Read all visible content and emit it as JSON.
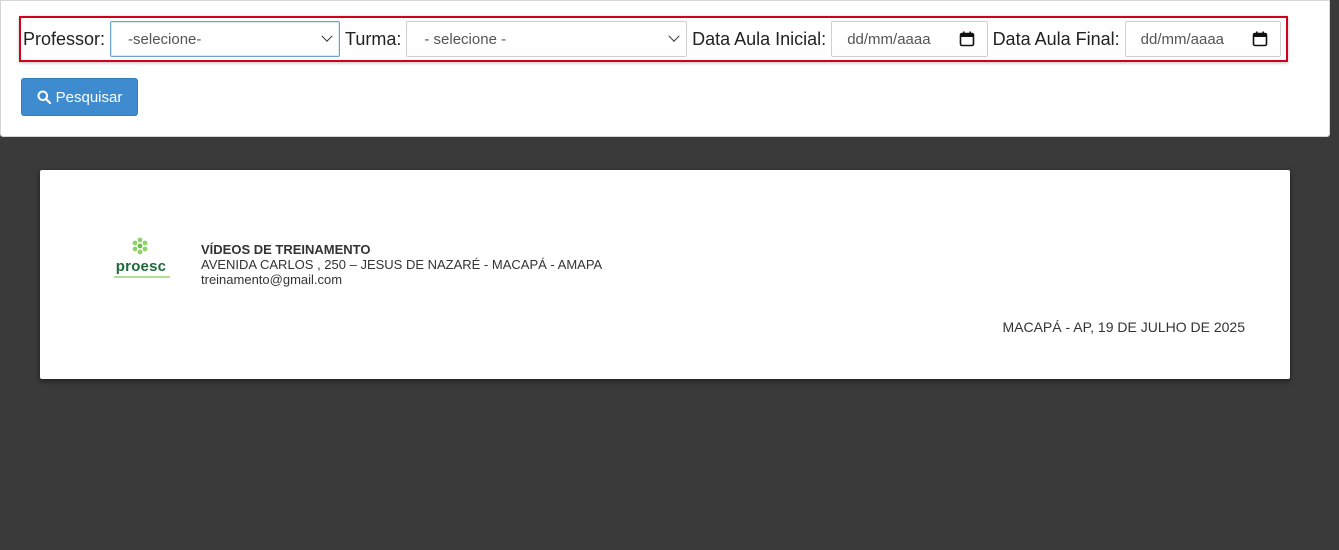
{
  "filters": {
    "professor_label": "Professor:",
    "professor_value": "-selecione-",
    "turma_label": "Turma:",
    "turma_value": "- selecione -",
    "data_inicial_label": "Data Aula Inicial:",
    "data_inicial_placeholder": "dd/mm/aaaa",
    "data_final_label": "Data Aula Final:",
    "data_final_placeholder": "dd/mm/aaaa"
  },
  "search_button": {
    "label": "Pesquisar",
    "icon": "search-icon"
  },
  "report": {
    "logo_text": "proesc",
    "company_name": "VÍDEOS DE TREINAMENTO",
    "address": "AVENIDA CARLOS , 250 – JESUS DE NAZARÉ - MACAPÁ - AMAPA",
    "email": "treinamento@gmail.com",
    "place_date": "MACAPÁ - AP, 19 DE JULHO DE 2025"
  },
  "colors": {
    "highlight_border": "#d0021b",
    "primary_button": "#3e8bd0",
    "page_background": "#3a3a3a",
    "logo_green": "#1e6b3a",
    "logo_light_green": "#8fd26a"
  }
}
